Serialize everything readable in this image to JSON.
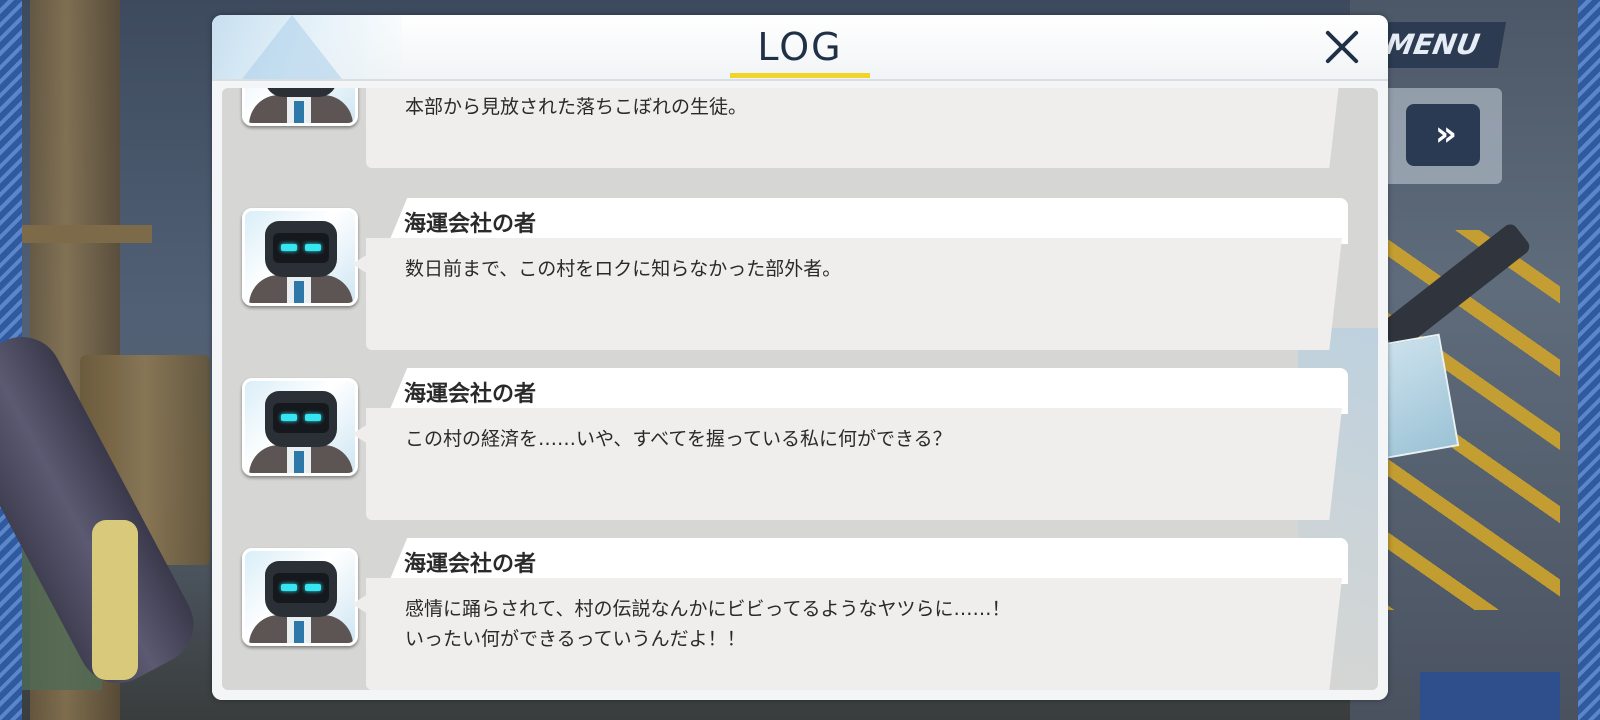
{
  "background": {
    "menu_label": "MENU",
    "skip_icon": "fast-forward-icon",
    "skip_glyph": "»"
  },
  "log": {
    "title": "LOG",
    "close_icon": "close-icon",
    "accent_color": "#f2d52a",
    "entries": [
      {
        "speaker": "",
        "text": "本部から見放された落ちこぼれの生徒。",
        "avatar_icon": "robot-avatar-icon"
      },
      {
        "speaker": "海運会社の者",
        "text": "数日前まで、この村をロクに知らなかった部外者。",
        "avatar_icon": "robot-avatar-icon"
      },
      {
        "speaker": "海運会社の者",
        "text": "この村の経済を……いや、すべてを握っている私に何ができる？",
        "avatar_icon": "robot-avatar-icon"
      },
      {
        "speaker": "海運会社の者",
        "text": "感情に踊らされて、村の伝説なんかにビビってるようなヤツらに……！\nいったい何ができるっていうんだよ！！",
        "avatar_icon": "robot-avatar-icon"
      }
    ]
  }
}
